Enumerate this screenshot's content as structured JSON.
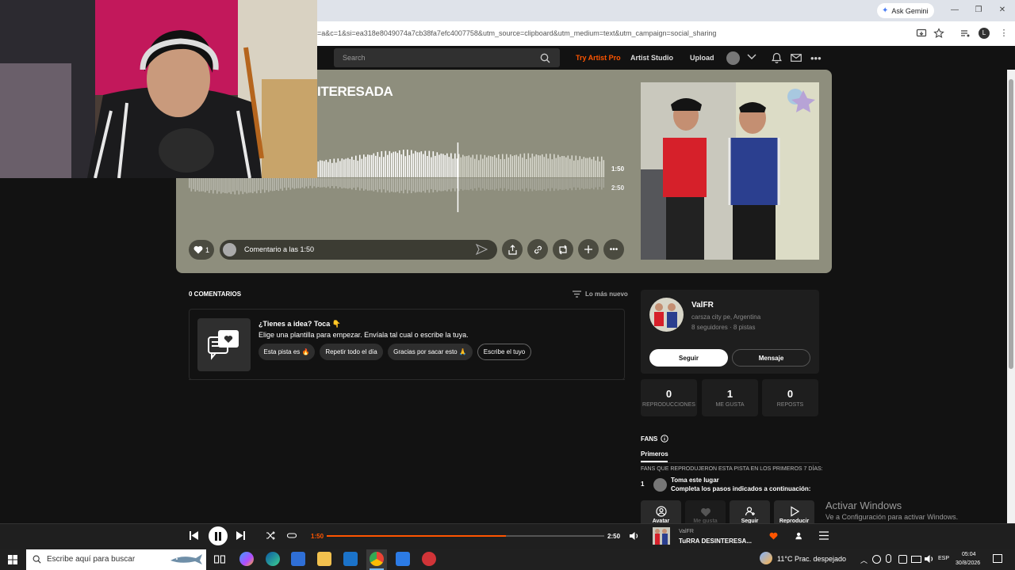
{
  "browser": {
    "url": "=a&c=1&si=ea318e8049074a7cb38fa7efc4007758&utm_source=clipboard&utm_medium=text&utm_campaign=social_sharing",
    "ask_gemini": "Ask Gemini",
    "profile_initial": "L"
  },
  "header": {
    "search_placeholder": "Search",
    "try_pro": "Try Artist Pro",
    "artist_studio": "Artist Studio",
    "upload": "Upload"
  },
  "track": {
    "title_visible": "ITERESADA",
    "current_time": "1:50",
    "duration": "2:50",
    "progress_fraction": 0.647,
    "likes": "1",
    "comment_placeholder": "Comentario a las 1:50"
  },
  "comments": {
    "count_label": "0 COMENTARIOS",
    "sort_label": "Lo más nuevo",
    "idea_title": "¿Tienes a idea? Toca 👇",
    "idea_subtitle": "Elige una plantilla para empezar. Envíala tal cual o escribe la tuya.",
    "chips": [
      "Esta pista es 🔥",
      "Repetir todo el día",
      "Gracias por sacar esto 🙏",
      "Escribe el tuyo"
    ]
  },
  "artist": {
    "name": "ValFR",
    "location": "carsza city pe, Argentina",
    "stats": "8 seguidores · 8 pistas",
    "follow": "Seguir",
    "message": "Mensaje"
  },
  "stats": [
    {
      "value": "0",
      "label": "REPRODUCCIONES"
    },
    {
      "value": "1",
      "label": "ME GUSTA"
    },
    {
      "value": "0",
      "label": "REPOSTS"
    }
  ],
  "fans": {
    "title": "FANS",
    "tab": "Primeros",
    "description": "FANS QUE REPRODUJERON ESTA PISTA EN LOS PRIMEROS 7 DÍAS:",
    "rank": "1",
    "fan_name": "Toma este lugar",
    "fan_sub": "Completa los pasos indicados a continuación:",
    "tiles": [
      "Avatar",
      "Me gusta",
      "Seguir",
      "Reproducir"
    ]
  },
  "windows_activation": {
    "title": "Activar Windows",
    "subtitle": "Ve a Configuración para activar Windows."
  },
  "player": {
    "current_time": "1:50",
    "duration": "2:50",
    "artist": "ValFR",
    "track": "TuRRA DESINTERESA..."
  },
  "taskbar": {
    "search_placeholder": "Escribe aquí para buscar",
    "weather": "11°C  Prac. despejado",
    "lang": "ESP",
    "time": "05:04",
    "date": "30/8/2026"
  },
  "colors": {
    "accent": "#ff5500",
    "hero_bg": "#8e8e7d",
    "page_bg": "#121212"
  }
}
